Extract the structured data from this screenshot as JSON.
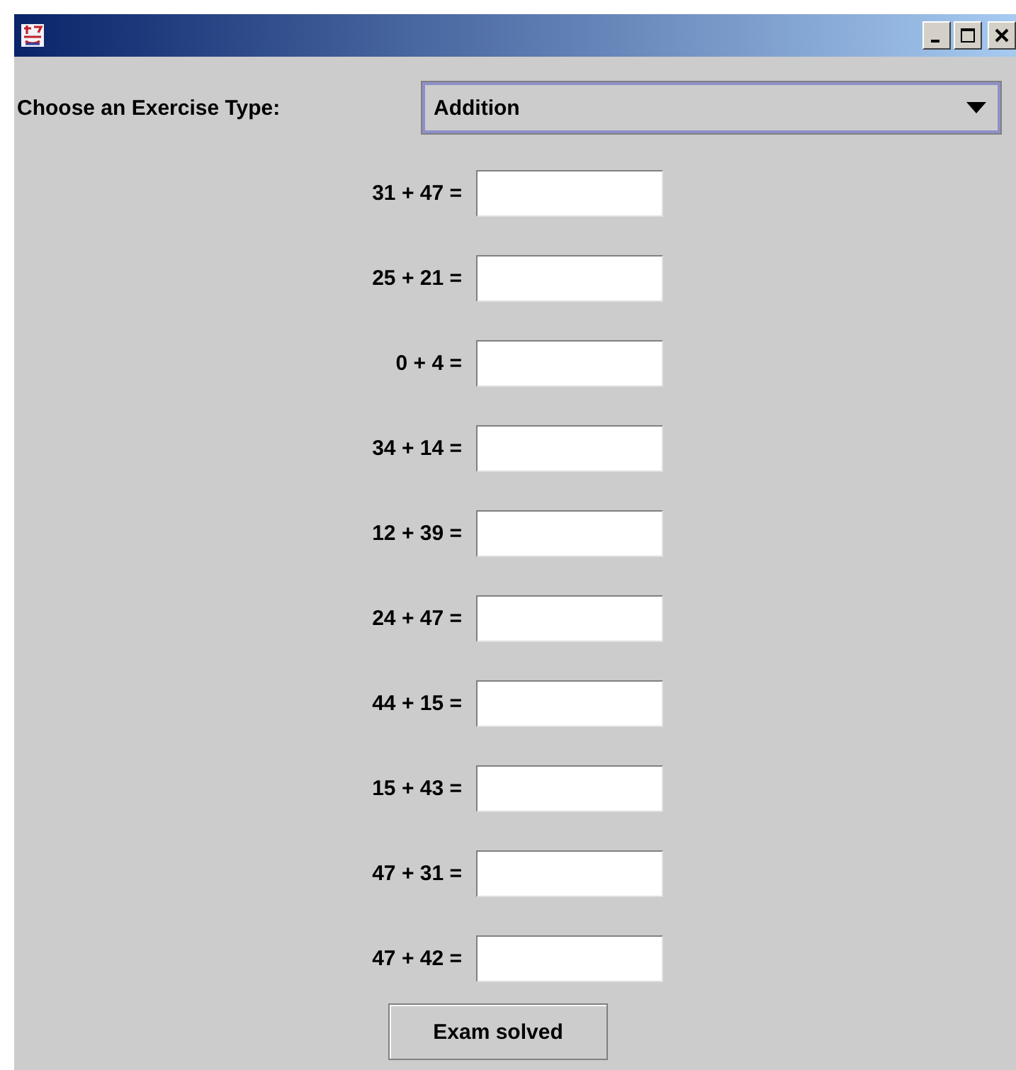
{
  "exercise_type": {
    "label": "Choose an Exercise Type:",
    "value": "Addition"
  },
  "exercises": [
    {
      "question": "31 + 47 ="
    },
    {
      "question": "25 + 21 ="
    },
    {
      "question": "0 + 4 ="
    },
    {
      "question": "34 + 14 ="
    },
    {
      "question": "12 + 39 ="
    },
    {
      "question": "24 + 47 ="
    },
    {
      "question": "44 + 15 ="
    },
    {
      "question": "15 + 43 ="
    },
    {
      "question": "47 + 31 ="
    },
    {
      "question": "47 + 42 ="
    }
  ],
  "buttons": [
    "Exam solved"
  ]
}
